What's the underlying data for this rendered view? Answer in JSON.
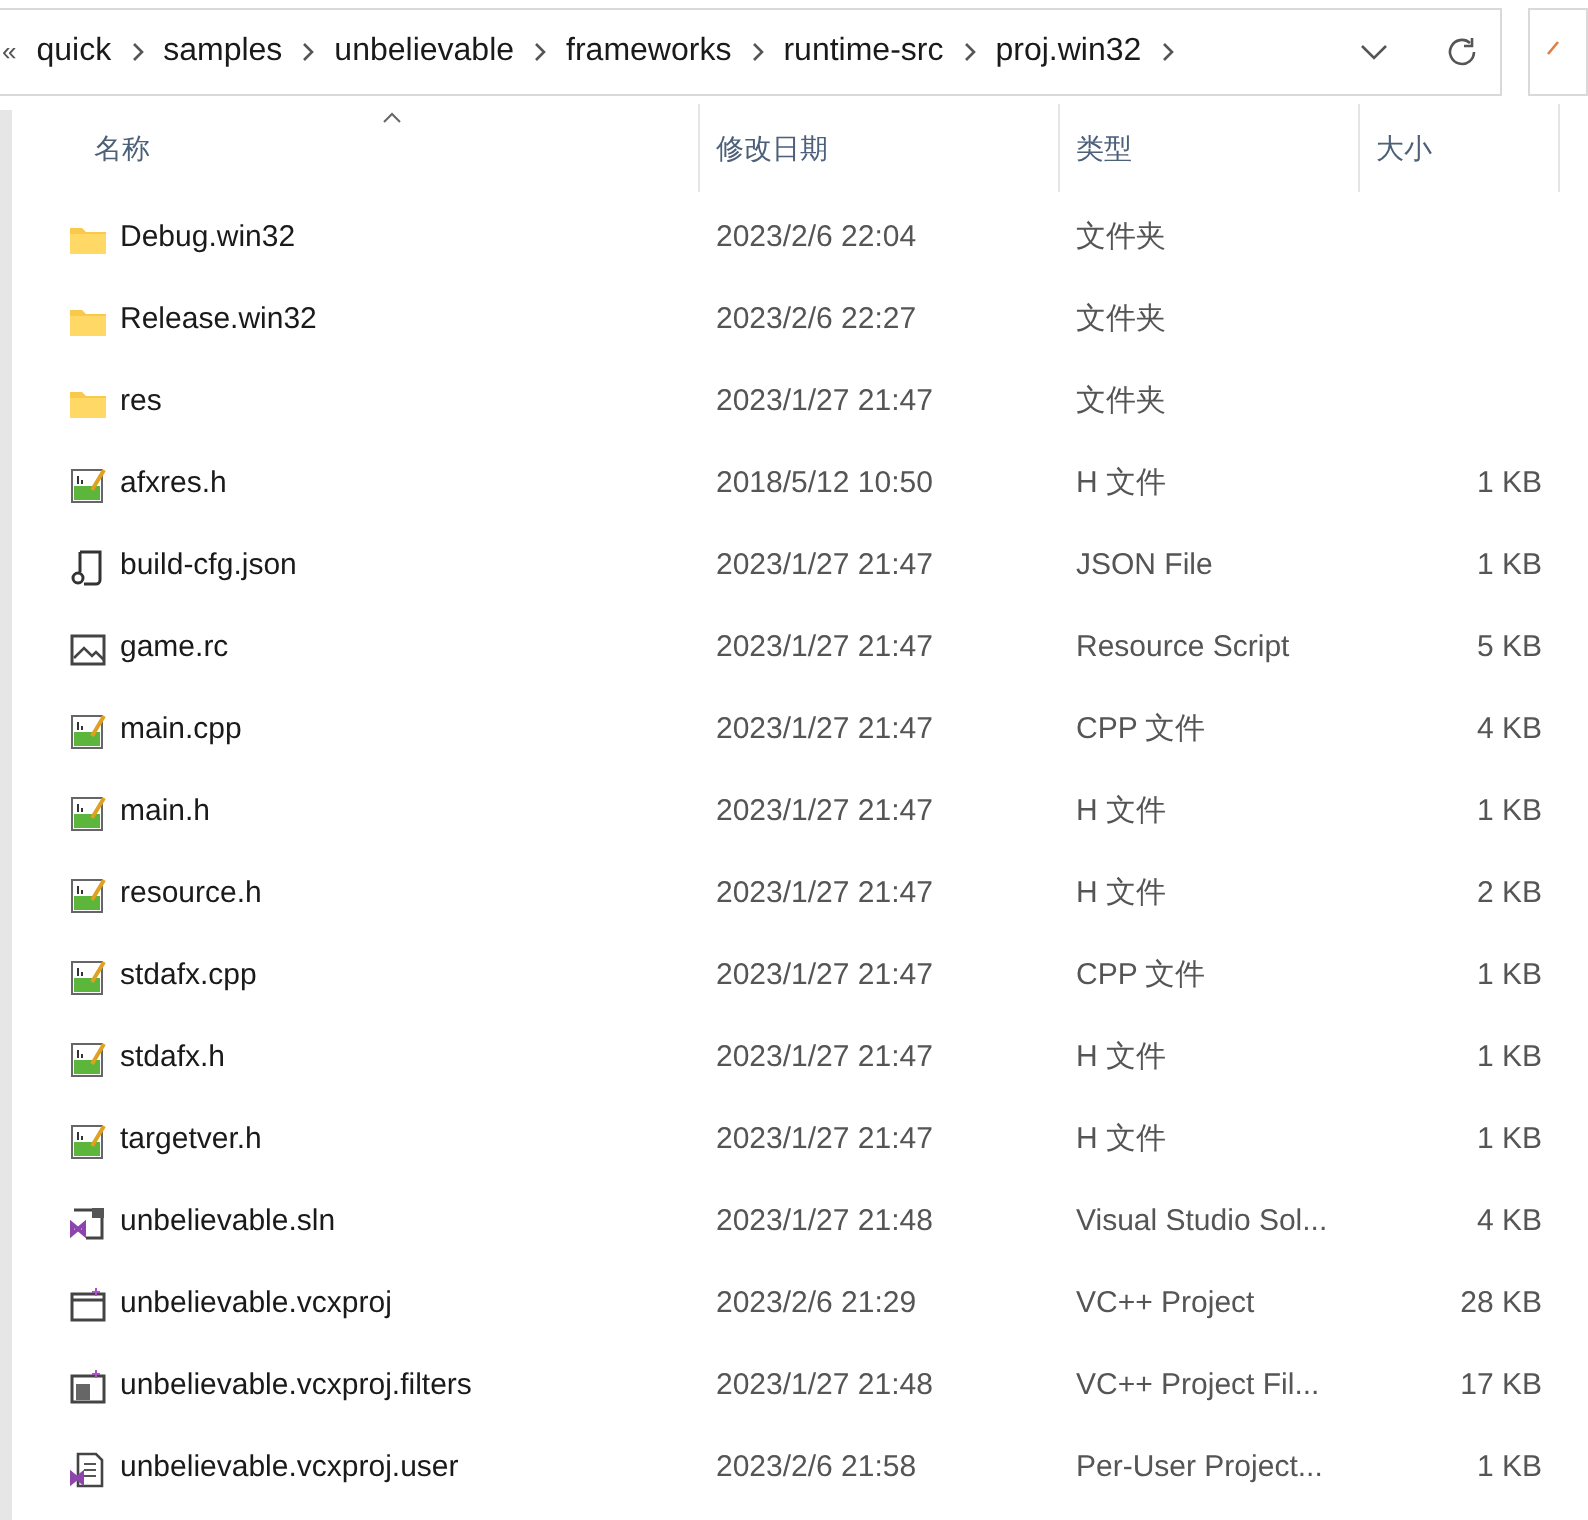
{
  "address_bar": {
    "overflow": "«",
    "crumbs": [
      "quick",
      "samples",
      "unbelievable",
      "frameworks",
      "runtime-src",
      "proj.win32"
    ]
  },
  "columns": [
    {
      "label": "名称",
      "sorted": true
    },
    {
      "label": "修改日期",
      "sorted": false
    },
    {
      "label": "类型",
      "sorted": false
    },
    {
      "label": "大小",
      "sorted": false
    }
  ],
  "files": [
    {
      "kind": "folder",
      "name": "Debug.win32",
      "modified": "2023/2/6 22:04",
      "type": "文件夹"
    },
    {
      "kind": "folder",
      "name": "Release.win32",
      "modified": "2023/2/6 22:27",
      "type": "文件夹"
    },
    {
      "kind": "folder",
      "name": "res",
      "modified": "2023/1/27 21:47",
      "type": "文件夹"
    },
    {
      "kind": "code",
      "name": "afxres.h",
      "modified": "2018/5/12 10:50",
      "type": "H 文件",
      "size": "1 KB"
    },
    {
      "kind": "json",
      "name": "build-cfg.json",
      "modified": "2023/1/27 21:47",
      "type": "JSON File",
      "size": "1 KB"
    },
    {
      "kind": "image",
      "name": "game.rc",
      "modified": "2023/1/27 21:47",
      "type": "Resource Script",
      "size": "5 KB"
    },
    {
      "kind": "code",
      "name": "main.cpp",
      "modified": "2023/1/27 21:47",
      "type": "CPP 文件",
      "size": "4 KB"
    },
    {
      "kind": "code",
      "name": "main.h",
      "modified": "2023/1/27 21:47",
      "type": "H 文件",
      "size": "1 KB"
    },
    {
      "kind": "code",
      "name": "resource.h",
      "modified": "2023/1/27 21:47",
      "type": "H 文件",
      "size": "2 KB"
    },
    {
      "kind": "code",
      "name": "stdafx.cpp",
      "modified": "2023/1/27 21:47",
      "type": "CPP 文件",
      "size": "1 KB"
    },
    {
      "kind": "code",
      "name": "stdafx.h",
      "modified": "2023/1/27 21:47",
      "type": "H 文件",
      "size": "1 KB"
    },
    {
      "kind": "code",
      "name": "targetver.h",
      "modified": "2023/1/27 21:47",
      "type": "H 文件",
      "size": "1 KB"
    },
    {
      "kind": "solution",
      "name": "unbelievable.sln",
      "modified": "2023/1/27 21:48",
      "type": "Visual Studio Sol...",
      "size": "4 KB"
    },
    {
      "kind": "project",
      "name": "unbelievable.vcxproj",
      "modified": "2023/2/6 21:29",
      "type": "VC++ Project",
      "size": "28 KB"
    },
    {
      "kind": "filters",
      "name": "unbelievable.vcxproj.filters",
      "modified": "2023/1/27 21:48",
      "type": "VC++ Project Fil...",
      "size": "17 KB"
    },
    {
      "kind": "user",
      "name": "unbelievable.vcxproj.user",
      "modified": "2023/2/6 21:58",
      "type": "Per-User Project...",
      "size": "1 KB"
    }
  ]
}
